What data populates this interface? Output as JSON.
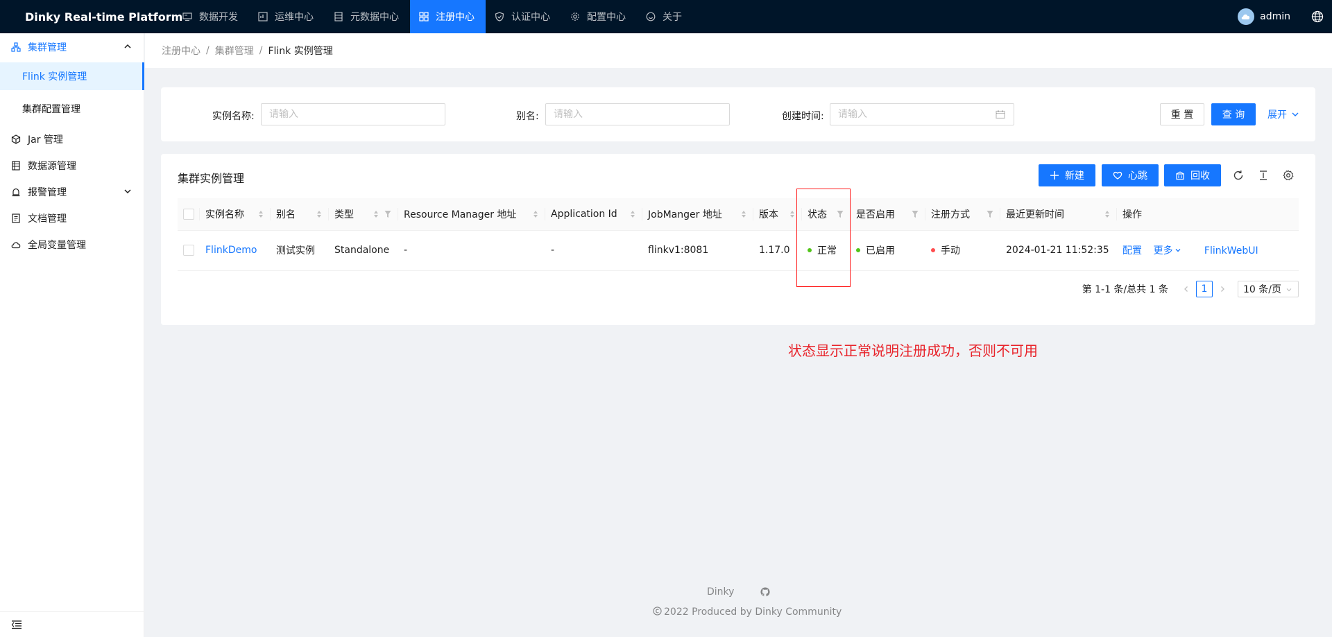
{
  "app": {
    "title": "Dinky Real-time Platform",
    "user": "admin",
    "accent_color": "#1677ff",
    "header_bg": "#001529"
  },
  "topnav": [
    {
      "label": "数据开发",
      "icon": "monitor-icon"
    },
    {
      "label": "运维中心",
      "icon": "dashboard-icon"
    },
    {
      "label": "元数据中心",
      "icon": "database-icon"
    },
    {
      "label": "注册中心",
      "icon": "appstore-icon",
      "active": true
    },
    {
      "label": "认证中心",
      "icon": "shield-icon"
    },
    {
      "label": "配置中心",
      "icon": "gear-icon"
    },
    {
      "label": "关于",
      "icon": "smile-icon"
    }
  ],
  "sidebar": {
    "items": [
      {
        "label": "集群管理",
        "icon": "cluster-icon",
        "expanded": true
      },
      {
        "label": "Flink 实例管理",
        "selected": true
      },
      {
        "label": "集群配置管理"
      },
      {
        "label": "Jar 管理",
        "icon": "code-sandbox-icon"
      },
      {
        "label": "数据源管理",
        "icon": "table-icon"
      },
      {
        "label": "报警管理",
        "icon": "alert-icon",
        "expanded": false
      },
      {
        "label": "文档管理",
        "icon": "document-icon"
      },
      {
        "label": "全局变量管理",
        "icon": "cloud-icon"
      }
    ]
  },
  "breadcrumb": [
    "注册中心",
    "集群管理",
    "Flink 实例管理"
  ],
  "search": {
    "fields": [
      {
        "label": "实例名称:",
        "placeholder": "请输入"
      },
      {
        "label": "别名:",
        "placeholder": "请输入"
      },
      {
        "label": "创建时间:",
        "placeholder": "请输入"
      }
    ],
    "reset_label": "重 置",
    "query_label": "查 询",
    "expand_label": "展开"
  },
  "table": {
    "title": "集群实例管理",
    "buttons": {
      "new": "新建",
      "heartbeat": "心跳",
      "recycle": "回收"
    },
    "columns": [
      "实例名称",
      "别名",
      "类型",
      "Resource Manager 地址",
      "Application Id",
      "JobManger 地址",
      "版本",
      "状态",
      "是否启用",
      "注册方式",
      "最近更新时间",
      "操作"
    ],
    "rows": [
      {
        "name": "FlinkDemo",
        "alias": "测试实例",
        "type": "Standalone",
        "rm_address": "-",
        "app_id": "-",
        "jm_address": "flinkv1:8081",
        "version": "1.17.0",
        "status": "正常",
        "status_color": "#52c41a",
        "enabled": "已启用",
        "enabled_color": "#52c41a",
        "register": "手动",
        "register_color": "#ff4d4f",
        "updated": "2024-01-21 11:52:35",
        "actions": {
          "config": "配置",
          "more": "更多",
          "webui": "FlinkWebUI"
        }
      }
    ],
    "pagination": {
      "total_text": "第 1-1 条/总共 1 条",
      "current": "1",
      "page_size": "10 条/页"
    }
  },
  "annotation": {
    "note": "状态显示正常说明注册成功，否则不可用",
    "color": "#e8242b"
  },
  "footer": {
    "link": "Dinky",
    "copyright": "2022 Produced by Dinky Community"
  }
}
